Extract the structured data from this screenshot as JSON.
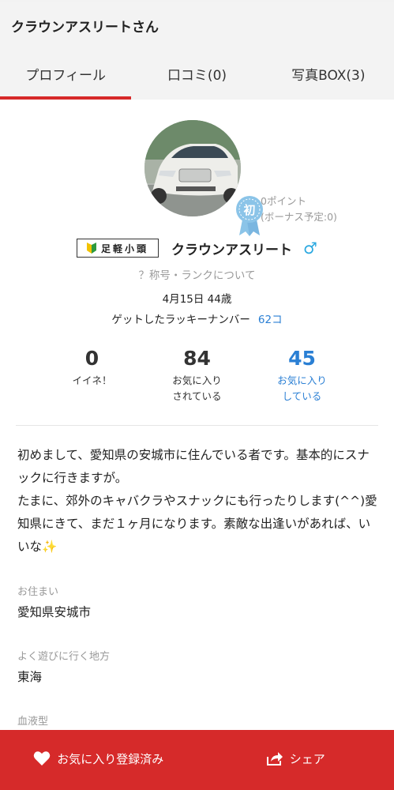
{
  "header": {
    "title": "クラウンアスリートさん"
  },
  "tabs": [
    {
      "label": "プロフィール",
      "active": true
    },
    {
      "label": "口コミ(0)",
      "active": false
    },
    {
      "label": "写真BOX(3)",
      "active": false
    }
  ],
  "profile": {
    "badge_char": "初",
    "points": "0ポイント",
    "bonus": "(ボーナス予定:0)",
    "title_badge": "足軽小頭",
    "username": "クラウンアスリート",
    "gender_symbol": "♂",
    "rank_link": "？称号・ランクについて",
    "birthday": "4月15日 44歳",
    "lucky_label": "ゲットしたラッキーナンバー",
    "lucky_value": "62コ"
  },
  "stats": [
    {
      "value": "0",
      "label": "イイネ！",
      "highlight": false
    },
    {
      "value": "84",
      "label": "お気に入り\nされている",
      "highlight": false
    },
    {
      "value": "45",
      "label": "お気に入り\nしている",
      "highlight": true
    }
  ],
  "bio": "初めまして、愛知県の安城市に住んでいる者です。基本的にスナックに行きますが。\nたまに、郊外のキャバクラやスナックにも行ったりします(^^)愛知県にきて、まだ１ヶ月になります。素敵な出逢いがあれば、いいな✨",
  "fields": [
    {
      "label": "お住まい",
      "value": "愛知県安城市"
    },
    {
      "label": "よく遊びに行く地方",
      "value": "東海"
    },
    {
      "label": "血液型",
      "value": ""
    }
  ],
  "bottom_bar": {
    "favorite_label": "お気に入り登録済み",
    "share_label": "シェア"
  },
  "colors": {
    "accent": "#d62a2a",
    "link": "#2a7fd4",
    "gender": "#2aa8e0",
    "badge": "#8bc4e8"
  }
}
